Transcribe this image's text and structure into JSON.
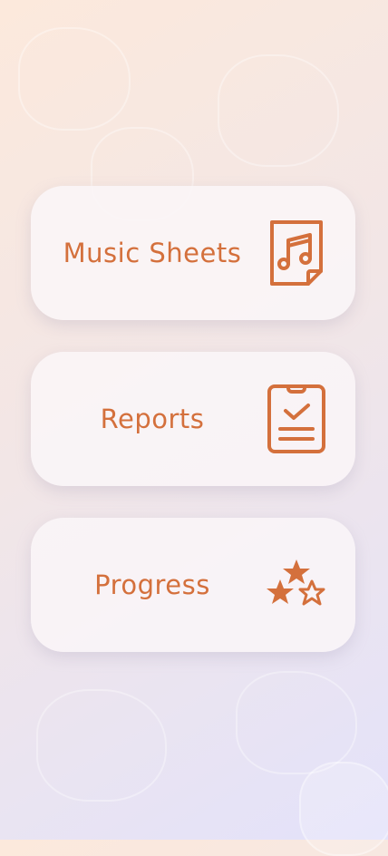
{
  "menu": {
    "items": [
      {
        "label": "Music Sheets",
        "icon": "music-sheet-icon"
      },
      {
        "label": "Reports",
        "icon": "clipboard-check-icon"
      },
      {
        "label": "Progress",
        "icon": "stars-icon"
      }
    ]
  },
  "colors": {
    "accent": "#d4703c"
  }
}
